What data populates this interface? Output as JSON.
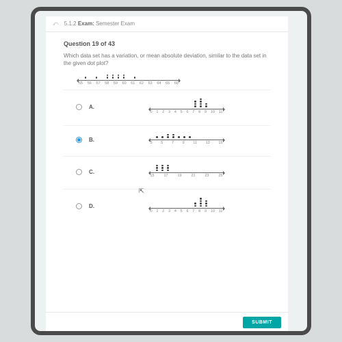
{
  "breadcrumb": {
    "back": "⤺",
    "code": "5.1.2",
    "label": "Exam:",
    "name": "Semester Exam"
  },
  "question": {
    "heading": "Question 19 of 43",
    "stem": "Which data set has a variation, or mean absolute deviation, similar to the data set in the given dot plot?"
  },
  "chart_data": {
    "type": "dotplot",
    "ticks": [
      "55",
      "56",
      "57",
      "58",
      "59",
      "60",
      "61",
      "62",
      "63",
      "64",
      "65",
      "66"
    ],
    "counts": [
      1,
      0,
      1,
      0,
      2,
      2,
      2,
      2,
      0,
      1,
      0,
      0
    ]
  },
  "options": {
    "A": {
      "label": "A.",
      "chart_data": {
        "type": "dotplot",
        "ticks": [
          "0",
          "1",
          "2",
          "3",
          "4",
          "5",
          "6",
          "7",
          "8",
          "9",
          "10",
          "11"
        ],
        "counts": [
          0,
          0,
          0,
          0,
          0,
          0,
          0,
          3,
          4,
          2,
          0,
          0
        ]
      }
    },
    "B": {
      "label": "B.",
      "chart_data": {
        "type": "dotplot",
        "ticks": [
          "3",
          "5",
          "7",
          "9",
          "11",
          "13",
          "15"
        ],
        "counts": [
          1,
          1,
          2,
          2,
          1,
          1,
          1
        ]
      },
      "selected": true
    },
    "C": {
      "label": "C.",
      "chart_data": {
        "type": "dotplot",
        "ticks": [
          "15",
          "17",
          "19",
          "21",
          "23",
          "25"
        ],
        "counts": [
          3,
          3,
          3,
          0,
          0,
          0
        ]
      }
    },
    "D": {
      "label": "D.",
      "chart_data": {
        "type": "dotplot",
        "ticks": [
          "0",
          "1",
          "2",
          "3",
          "4",
          "5",
          "6",
          "7",
          "8",
          "9",
          "10",
          "11"
        ],
        "counts": [
          0,
          0,
          0,
          0,
          0,
          0,
          0,
          2,
          4,
          3,
          0,
          0
        ]
      }
    }
  },
  "submit_label": "SUBMIT"
}
